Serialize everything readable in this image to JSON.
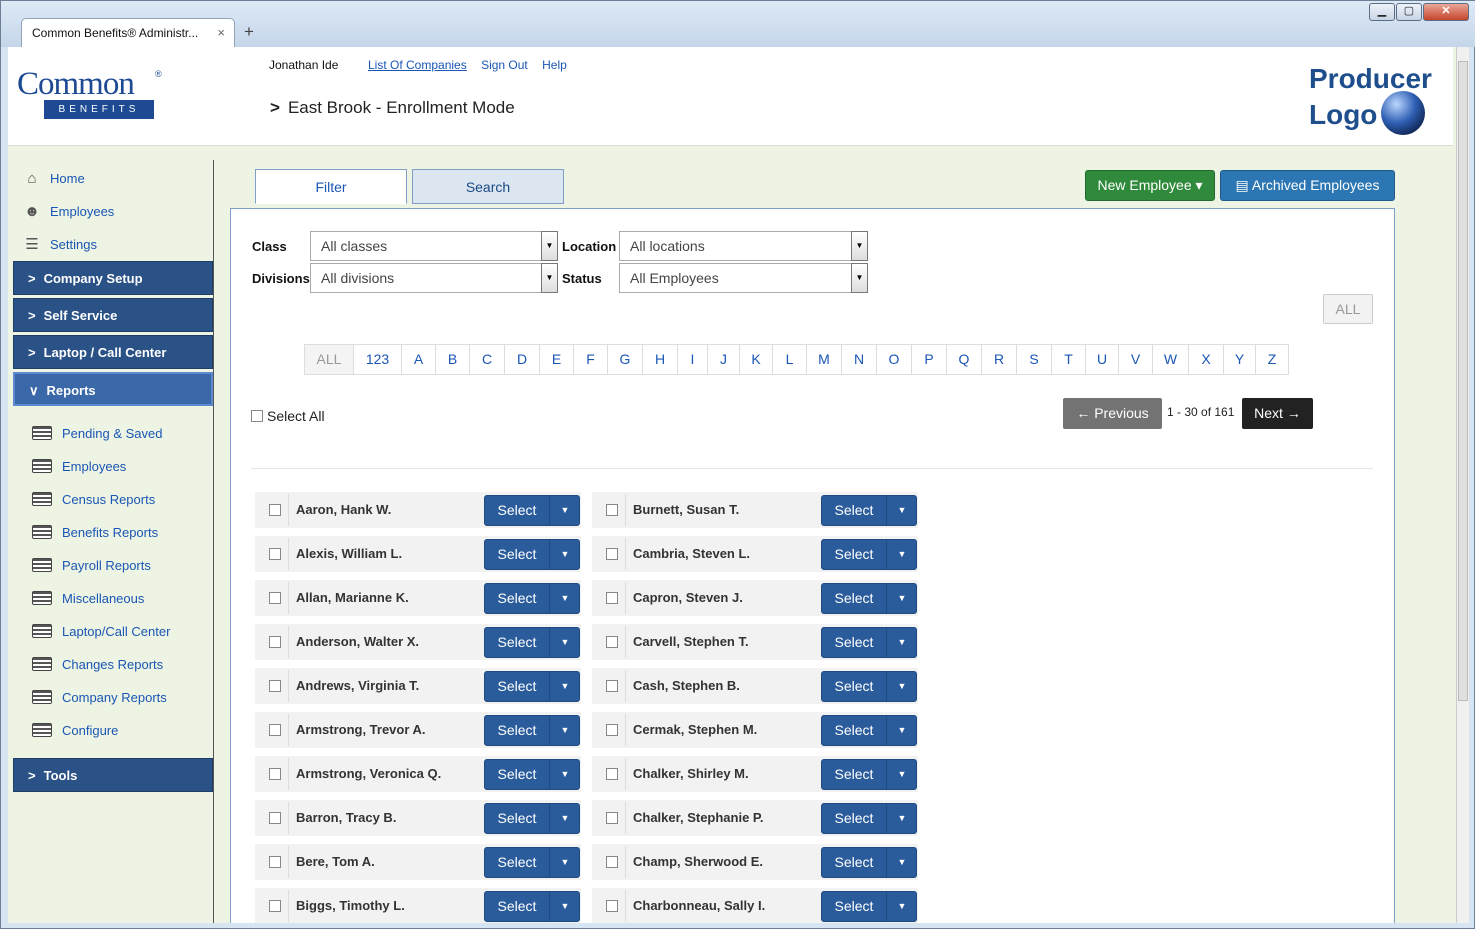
{
  "browser": {
    "tab_title": "Common Benefits® Administr...",
    "tab_close": "×",
    "new_tab": "+",
    "window_controls": {
      "minimize": "▁",
      "maximize": "▢",
      "close": "✕"
    }
  },
  "header": {
    "logo_word": "Common",
    "logo_reg": "®",
    "logo_sub": "BENEFITS",
    "user_name": "Jonathan Ide",
    "links": {
      "companies": "List Of Companies",
      "sign_out": "Sign Out",
      "help": "Help"
    },
    "mode": "East Brook - Enrollment Mode",
    "producer_line1": "Producer",
    "producer_line2": "Logo"
  },
  "sidebar": {
    "links": [
      {
        "label": "Home",
        "icon": "home-icon"
      },
      {
        "label": "Employees",
        "icon": "users-icon"
      },
      {
        "label": "Settings",
        "icon": "settings-icon"
      }
    ],
    "sections": {
      "company_setup": "Company Setup",
      "self_service": "Self Service",
      "laptop": "Laptop / Call Center",
      "reports": "Reports",
      "tools": "Tools"
    },
    "report_items": [
      "Pending & Saved",
      "Employees",
      "Census Reports",
      "Benefits Reports",
      "Payroll Reports",
      "Miscellaneous",
      "Laptop/Call Center",
      "Changes Reports",
      "Company Reports",
      "Configure"
    ]
  },
  "tabs": {
    "filter": "Filter",
    "search": "Search"
  },
  "actions": {
    "new_employee": "New Employee ▾",
    "archived": "Archived Employees"
  },
  "filters": {
    "class_label": "Class",
    "class_value": "All classes",
    "location_label": "Location",
    "location_value": "All locations",
    "divisions_label": "Divisions",
    "divisions_value": "All divisions",
    "status_label": "Status",
    "status_value": "All Employees",
    "all_button": "ALL"
  },
  "alphabet": [
    "ALL",
    "123",
    "A",
    "B",
    "C",
    "D",
    "E",
    "F",
    "G",
    "H",
    "I",
    "J",
    "K",
    "L",
    "M",
    "N",
    "O",
    "P",
    "Q",
    "R",
    "S",
    "T",
    "U",
    "V",
    "W",
    "X",
    "Y",
    "Z"
  ],
  "list": {
    "select_all": "Select All",
    "prev": "← Previous",
    "page_info": "1 - 30 of 161",
    "next": "Next →",
    "select_label": "Select",
    "col1": [
      "Aaron, Hank W.",
      "Alexis, William L.",
      "Allan, Marianne K.",
      "Anderson, Walter X.",
      "Andrews, Virginia T.",
      "Armstrong, Trevor A.",
      "Armstrong, Veronica Q.",
      "Barron, Tracy B.",
      "Bere, Tom A.",
      "Biggs, Timothy L."
    ],
    "col2": [
      "Burnett, Susan T.",
      "Cambria, Steven L.",
      "Capron, Steven J.",
      "Carvell, Stephen T.",
      "Cash, Stephen B.",
      "Cermak, Stephen M.",
      "Chalker, Shirley M.",
      "Chalker, Stephanie P.",
      "Champ, Sherwood E.",
      "Charbonneau, Sally I."
    ]
  }
}
